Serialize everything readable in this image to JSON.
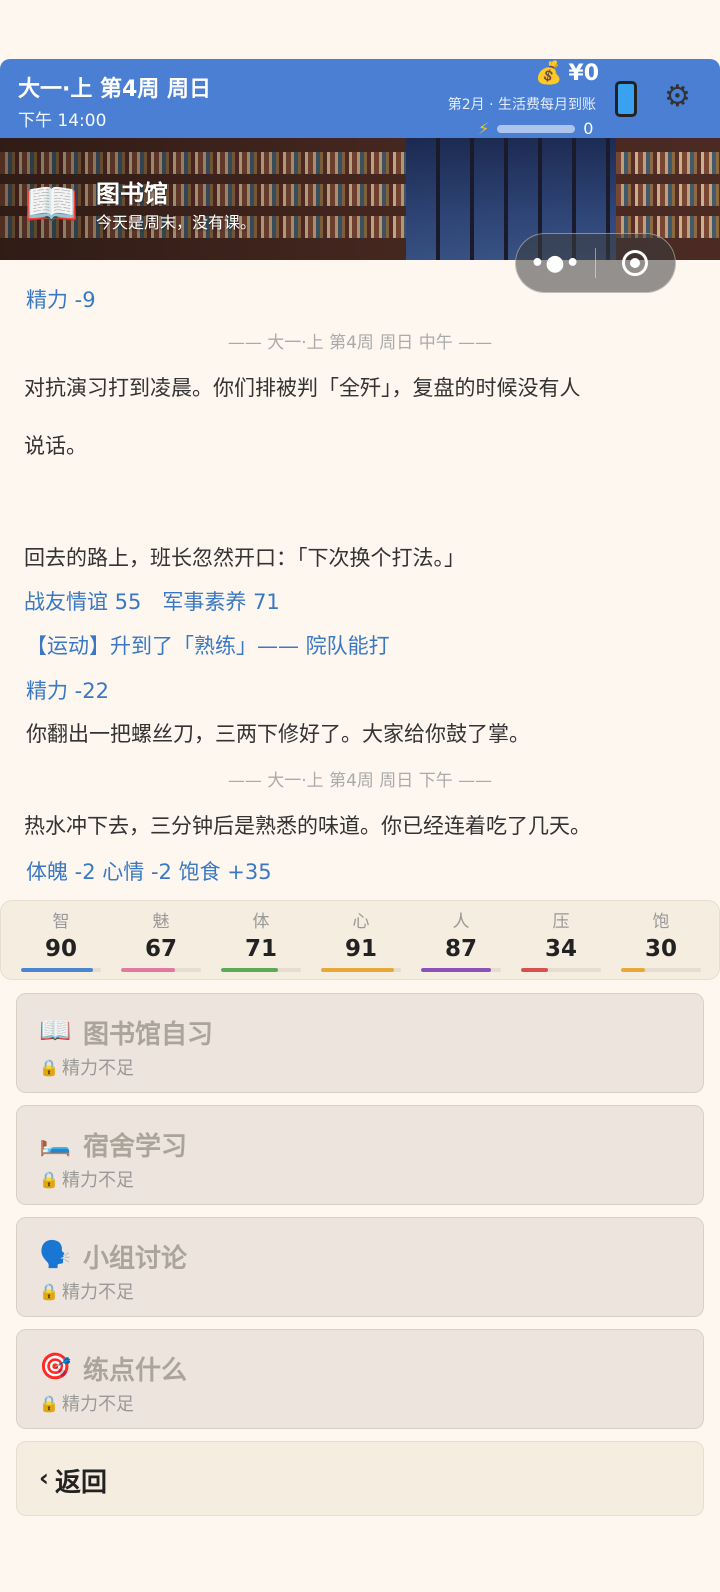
{
  "header": {
    "title": "大一·上 第4周 周日",
    "time": "下午 14:00",
    "money": "¥0",
    "money_icon": "money-bag-icon",
    "month_info": "第2月 · 生活费每月到账",
    "energy_value": "0",
    "energy_icon": "lightning-icon",
    "energy_level": 0
  },
  "location": {
    "icon": "book-icon",
    "name": "图书馆",
    "subtitle": "今天是周末，没有课。"
  },
  "miniapp_capsule": {
    "more": "•●•"
  },
  "log": {
    "line_energy_9": "精力 -9",
    "divider_noon": "—— 大一·上 第4周 周日 中午 ——",
    "para1_line1": "对抗演习打到凌晨。你们排被判「全歼」，复盘的时候没有人",
    "para1_line2": "说话。",
    "para2": "回去的路上，班长忽然开口：「下次换个打法。」",
    "stat_changes": "战友情谊 55　军事素养 71",
    "skill_up": "【运动】升到了「熟练」—— 院队能打",
    "energy_22": "精力 -22",
    "para3": "你翻出一把螺丝刀，三两下修好了。大家给你鼓了掌。",
    "divider_afternoon": "—— 大一·上 第4周 周日 下午 ——",
    "para4": "热水冲下去，三分钟后是熟悉的味道。你已经连着吃了几天。",
    "stat_changes2": "体魄 -2  心情 -2  饱食 +35"
  },
  "stats": [
    {
      "label": "智",
      "value": "90",
      "level": 0.9,
      "color": "#4a86d0"
    },
    {
      "label": "魅",
      "value": "67",
      "level": 0.67,
      "color": "#e07aa0"
    },
    {
      "label": "体",
      "value": "71",
      "level": 0.71,
      "color": "#5aaa5a"
    },
    {
      "label": "心",
      "value": "91",
      "level": 0.91,
      "color": "#e8a838"
    },
    {
      "label": "人",
      "value": "87",
      "level": 0.87,
      "color": "#8a52b8"
    },
    {
      "label": "压",
      "value": "34",
      "level": 0.34,
      "color": "#d85050"
    },
    {
      "label": "饱",
      "value": "30",
      "level": 0.3,
      "color": "#e8a838"
    }
  ],
  "actions": [
    {
      "icon": "open-book-icon",
      "label": "图书馆自习",
      "sub": "精力不足"
    },
    {
      "icon": "bed-icon",
      "label": "宿舍学习",
      "sub": "精力不足"
    },
    {
      "icon": "speaking-head-icon",
      "label": "小组讨论",
      "sub": "精力不足"
    },
    {
      "icon": "target-icon",
      "label": "练点什么",
      "sub": "精力不足"
    }
  ],
  "back": {
    "label": "返回"
  }
}
